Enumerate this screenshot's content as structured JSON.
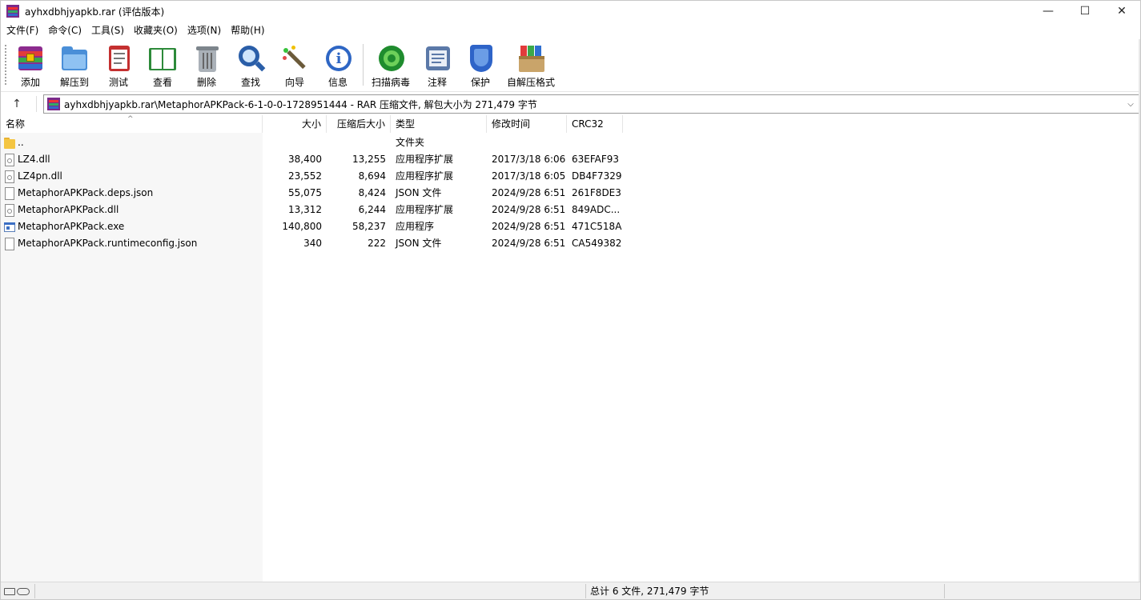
{
  "window": {
    "title": "ayhxdbhjyapkb.rar (评估版本)",
    "controls": {
      "minimize": "—",
      "maximize": "☐",
      "close": "✕"
    }
  },
  "menu": [
    {
      "label": "文件(F)"
    },
    {
      "label": "命令(C)"
    },
    {
      "label": "工具(S)"
    },
    {
      "label": "收藏夹(O)"
    },
    {
      "label": "选项(N)"
    },
    {
      "label": "帮助(H)"
    }
  ],
  "toolbar": [
    {
      "label": "添加",
      "icon": "add-archive-icon"
    },
    {
      "label": "解压到",
      "icon": "extract-folder-icon"
    },
    {
      "label": "测试",
      "icon": "test-clipboard-icon"
    },
    {
      "label": "查看",
      "icon": "view-book-icon"
    },
    {
      "label": "删除",
      "icon": "trash-icon"
    },
    {
      "label": "查找",
      "icon": "magnifier-icon"
    },
    {
      "label": "向导",
      "icon": "wizard-wand-icon"
    },
    {
      "label": "信息",
      "icon": "info-icon"
    },
    {
      "label": "扫描病毒",
      "icon": "virus-scan-icon"
    },
    {
      "label": "注释",
      "icon": "comment-icon"
    },
    {
      "label": "保护",
      "icon": "shield-icon"
    },
    {
      "label": "自解压格式",
      "icon": "sfx-box-icon"
    }
  ],
  "address": {
    "up_symbol": "↑",
    "path": "ayhxdbhjyapkb.rar\\MetaphorAPKPack-6-1-0-0-1728951444 - RAR 压缩文件, 解包大小为 271,479 字节",
    "dropdown_symbol": "⌵"
  },
  "columns": {
    "name": "名称",
    "size": "大小",
    "packed": "压缩后大小",
    "type": "类型",
    "modified": "修改时间",
    "crc": "CRC32",
    "sort_indicator": "^"
  },
  "files": [
    {
      "name": "..",
      "size": "",
      "packed": "",
      "type": "文件夹",
      "modified": "",
      "crc": "",
      "icon": "folder-icon"
    },
    {
      "name": "LZ4.dll",
      "size": "38,400",
      "packed": "13,255",
      "type": "应用程序扩展",
      "modified": "2017/3/18 6:06",
      "crc": "63EFAF93",
      "icon": "dll-file-icon"
    },
    {
      "name": "LZ4pn.dll",
      "size": "23,552",
      "packed": "8,694",
      "type": "应用程序扩展",
      "modified": "2017/3/18 6:05",
      "crc": "DB4F7329",
      "icon": "dll-file-icon"
    },
    {
      "name": "MetaphorAPKPack.deps.json",
      "size": "55,075",
      "packed": "8,424",
      "type": "JSON 文件",
      "modified": "2024/9/28 6:51",
      "crc": "261F8DE3",
      "icon": "json-file-icon"
    },
    {
      "name": "MetaphorAPKPack.dll",
      "size": "13,312",
      "packed": "6,244",
      "type": "应用程序扩展",
      "modified": "2024/9/28 6:51",
      "crc": "849ADC...",
      "icon": "dll-file-icon"
    },
    {
      "name": "MetaphorAPKPack.exe",
      "size": "140,800",
      "packed": "58,237",
      "type": "应用程序",
      "modified": "2024/9/28 6:51",
      "crc": "471C518A",
      "icon": "exe-file-icon"
    },
    {
      "name": "MetaphorAPKPack.runtimeconfig.json",
      "size": "340",
      "packed": "222",
      "type": "JSON 文件",
      "modified": "2024/9/28 6:51",
      "crc": "CA549382",
      "icon": "json-file-icon"
    }
  ],
  "status": {
    "summary": "总计 6 文件, 271,479 字节"
  }
}
